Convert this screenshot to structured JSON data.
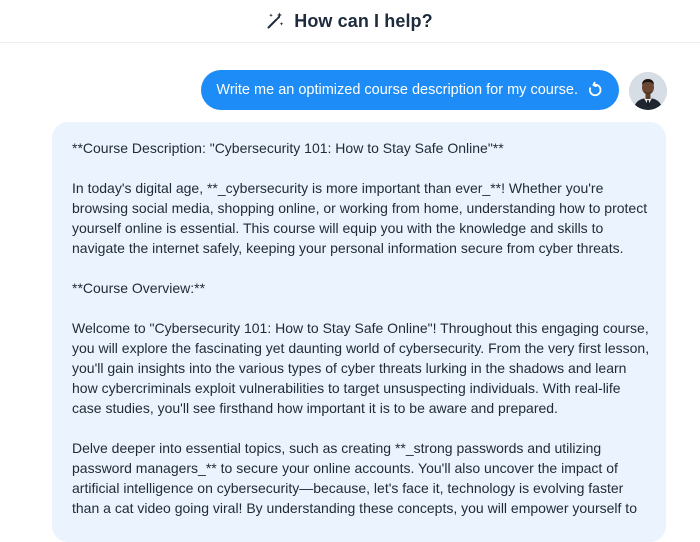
{
  "header": {
    "title": "How can I help?",
    "icon": "magic-wand-icon"
  },
  "colors": {
    "accent": "#1d8cf6",
    "assistant_bg": "#eaf3fe",
    "text": "#1f2a37"
  },
  "user_message": {
    "text": "Write me an optimized course description for my course.",
    "regenerate_icon": "regenerate-icon"
  },
  "assistant_message": {
    "paragraphs": [
      "**Course Description: \"Cybersecurity 101: How to Stay Safe Online\"**",
      "In today's digital age, **_cybersecurity is more important than ever_**! Whether you're browsing social media, shopping online, or working from home, understanding how to protect yourself online is essential. This course will equip you with the knowledge and skills to navigate the internet safely, keeping your personal information secure from cyber threats.",
      "**Course Overview:**",
      "Welcome to \"Cybersecurity 101: How to Stay Safe Online\"! Throughout this engaging course, you will explore the fascinating yet daunting world of cybersecurity. From the very first lesson, you'll gain insights into the various types of cyber threats lurking in the shadows and learn how cybercriminals exploit vulnerabilities to target unsuspecting individuals. With real-life case studies, you'll see firsthand how important it is to be aware and prepared.",
      "Delve deeper into essential topics, such as creating **_strong passwords and utilizing password managers_** to secure your online accounts. You'll also uncover the impact of artificial intelligence on cybersecurity—because, let's face it, technology is evolving faster than a cat video going viral! By understanding these concepts, you will empower yourself to"
    ]
  }
}
